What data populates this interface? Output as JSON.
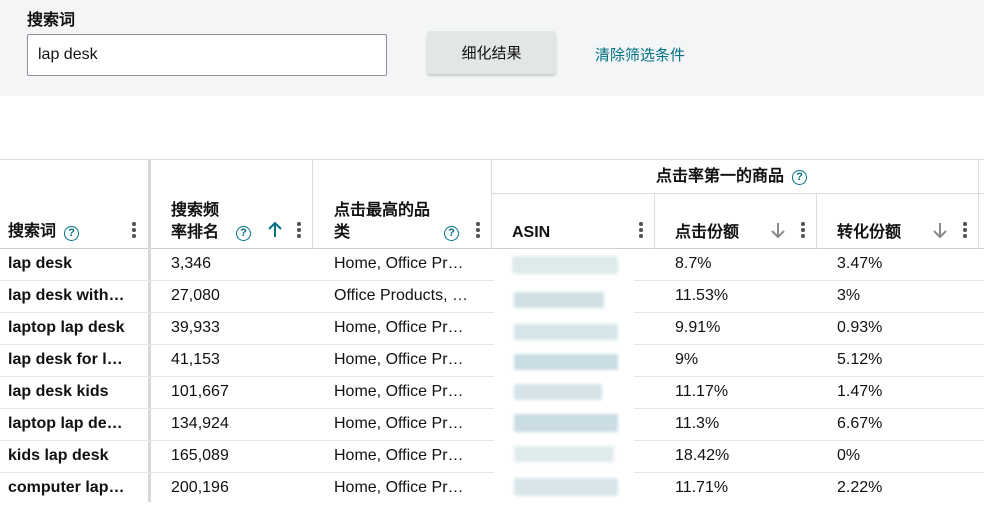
{
  "filter": {
    "label": "搜索词",
    "input_value": "lap desk",
    "refine_label": "细化结果",
    "clear_label": "清除筛选条件"
  },
  "table": {
    "group_header": "点击率第一的商品",
    "columns": {
      "search_term": "搜索词",
      "freq_rank_line1": "搜索频",
      "freq_rank_line2": "率排名",
      "category_line1": "点击最高的品",
      "category_line2": "类",
      "asin": "ASIN",
      "click_share": "点击份额",
      "conversion_share": "转化份额"
    },
    "rows": [
      {
        "term": "lap desk",
        "rank": "3,346",
        "category": "Home, Office Pr…",
        "click": "8.7%",
        "conv": "3.47%"
      },
      {
        "term": "lap desk with…",
        "rank": "27,080",
        "category": "Office Products, …",
        "click": "11.53%",
        "conv": "3%"
      },
      {
        "term": "laptop lap desk",
        "rank": "39,933",
        "category": "Home, Office Pr…",
        "click": "9.91%",
        "conv": "0.93%"
      },
      {
        "term": "lap desk for l…",
        "rank": "41,153",
        "category": "Home, Office Pr…",
        "click": "9%",
        "conv": "5.12%"
      },
      {
        "term": "lap desk kids",
        "rank": "101,667",
        "category": "Home, Office Pr…",
        "click": "11.17%",
        "conv": "1.47%"
      },
      {
        "term": "laptop lap de…",
        "rank": "134,924",
        "category": "Home, Office Pr…",
        "click": "11.3%",
        "conv": "6.67%"
      },
      {
        "term": "kids lap desk",
        "rank": "165,089",
        "category": "Home, Office Pr…",
        "click": "18.42%",
        "conv": "0%"
      },
      {
        "term": "computer lap…",
        "rank": "200,196",
        "category": "Home, Office Pr…",
        "click": "11.71%",
        "conv": "2.22%"
      }
    ]
  },
  "colors": {
    "accent": "#007185",
    "panel_bg": "#f3f5f6",
    "button_bg": "#e3e6e6"
  }
}
